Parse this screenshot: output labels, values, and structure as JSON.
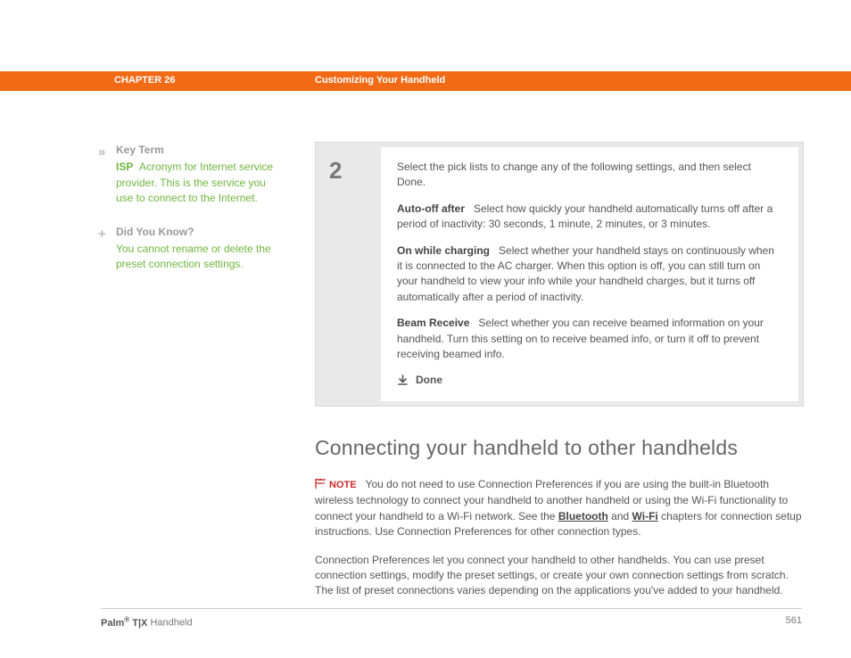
{
  "header": {
    "chapter": "CHAPTER 26",
    "title": "Customizing Your Handheld"
  },
  "sidebar": {
    "keyterm": {
      "mark": "»",
      "head": "Key Term",
      "term": "ISP",
      "body": "Acronym for Internet service provider. This is the service you use to connect to the Internet."
    },
    "dyk": {
      "mark": "+",
      "head": "Did You Know?",
      "body": "You cannot rename or delete the preset connection settings."
    }
  },
  "step": {
    "num": "2",
    "intro": "Select the pick lists to change any of the following settings, and then select Done.",
    "autooff_label": "Auto-off after",
    "autooff_body": "Select how quickly your handheld automatically turns off after a period of inactivity: 30 seconds, 1 minute, 2 minutes, or 3 minutes.",
    "onwhile_label": "On while charging",
    "onwhile_body": "Select whether your handheld stays on continuously when it is connected to the AC charger. When this option is off, you can still turn on your handheld to view your info while your handheld charges, but it turns off automatically after a period of inactivity.",
    "beam_label": "Beam Receive",
    "beam_body": "Select whether you can receive beamed information on your handheld. Turn this setting on to receive beamed info, or turn it off to prevent receiving beamed info.",
    "done": "Done"
  },
  "section": {
    "heading": "Connecting your handheld to other handhelds",
    "note_label": "NOTE",
    "note_pre": "You do not need to use Connection Preferences if you are using the built-in Bluetooth wireless technology to connect your handheld to another handheld or using the Wi-Fi functionality to connect your handheld to a Wi-Fi network. See the ",
    "bt": "Bluetooth",
    "and": " and ",
    "wifi": "Wi-Fi",
    "note_post": " chapters for connection setup instructions. Use Connection Preferences for other connection types.",
    "para2": "Connection Preferences let you connect your handheld to other handhelds. You can use preset connection settings, modify the preset settings, or create your own connection settings from scratch. The list of preset connections varies depending on the applications you've added to your handheld."
  },
  "footer": {
    "brand": "Palm",
    "reg": "®",
    "model": " T|X",
    "suffix": " Handheld",
    "page": "561"
  }
}
